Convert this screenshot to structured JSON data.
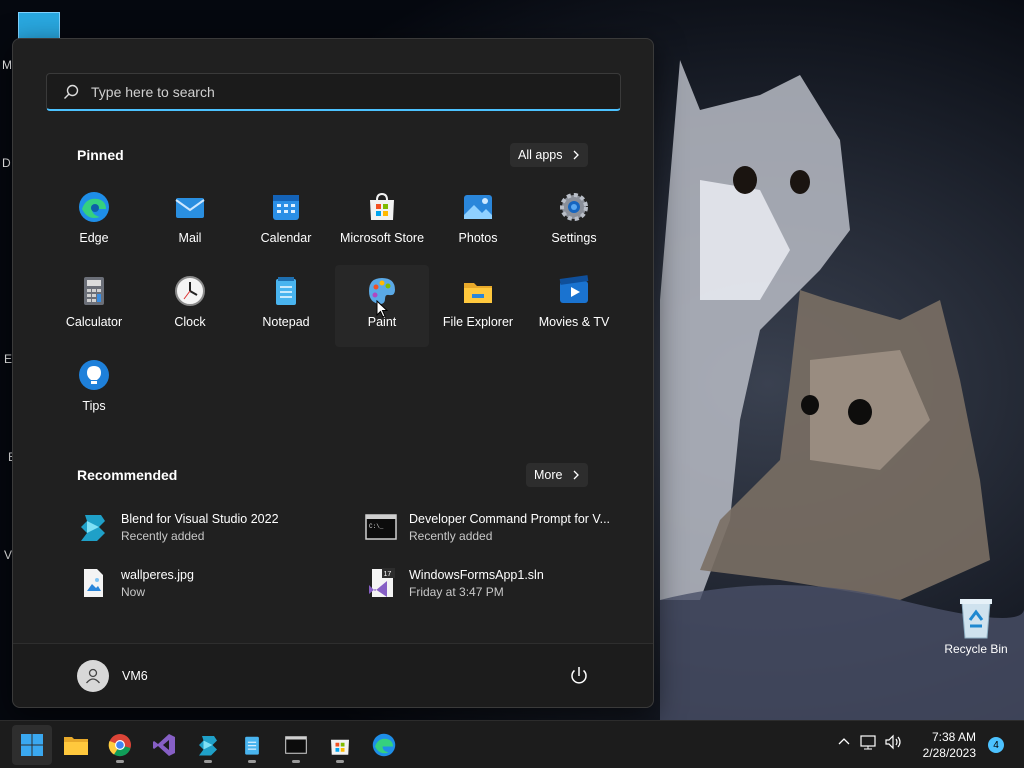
{
  "desktop": {
    "edge_labels": [
      "M",
      "D",
      "E",
      "E",
      "V"
    ],
    "recycle_bin": "Recycle Bin"
  },
  "start_menu": {
    "search_placeholder": "Type here to search",
    "pinned_title": "Pinned",
    "all_apps_label": "All apps",
    "pinned_apps": [
      {
        "label": "Edge",
        "icon": "edge-icon"
      },
      {
        "label": "Mail",
        "icon": "mail-icon"
      },
      {
        "label": "Calendar",
        "icon": "calendar-icon"
      },
      {
        "label": "Microsoft Store",
        "icon": "store-icon"
      },
      {
        "label": "Photos",
        "icon": "photos-icon"
      },
      {
        "label": "Settings",
        "icon": "gear-icon"
      },
      {
        "label": "Calculator",
        "icon": "calculator-icon"
      },
      {
        "label": "Clock",
        "icon": "clock-icon"
      },
      {
        "label": "Notepad",
        "icon": "notepad-icon"
      },
      {
        "label": "Paint",
        "icon": "palette-icon"
      },
      {
        "label": "File Explorer",
        "icon": "folder-icon"
      },
      {
        "label": "Movies & TV",
        "icon": "movies-icon"
      },
      {
        "label": "Tips",
        "icon": "lightbulb-icon"
      }
    ],
    "recommended_title": "Recommended",
    "more_label": "More",
    "recommended": [
      {
        "name": "Blend for Visual Studio 2022",
        "sub": "Recently added",
        "icon": "blend-icon"
      },
      {
        "name": "Developer Command Prompt for V...",
        "sub": "Recently added",
        "icon": "terminal-icon"
      },
      {
        "name": "wallperes.jpg",
        "sub": "Now",
        "icon": "image-file-icon"
      },
      {
        "name": "WindowsFormsApp1.sln",
        "sub": "Friday at 3:47 PM",
        "icon": "vs-solution-icon"
      }
    ],
    "user_name": "VM6",
    "sln_badge": "17"
  },
  "taskbar": {
    "apps": [
      "start-icon",
      "file-explorer-icon",
      "chrome-icon",
      "visual-studio-icon",
      "blend-icon",
      "notepad-icon",
      "terminal-icon",
      "store-icon",
      "edge-icon"
    ],
    "time": "7:38 AM",
    "date": "2/28/2023",
    "notification_count": "4"
  },
  "colors": {
    "accent": "#4cc2ff",
    "menu_bg": "#202020",
    "taskbar_bg": "#1c1c1c"
  }
}
